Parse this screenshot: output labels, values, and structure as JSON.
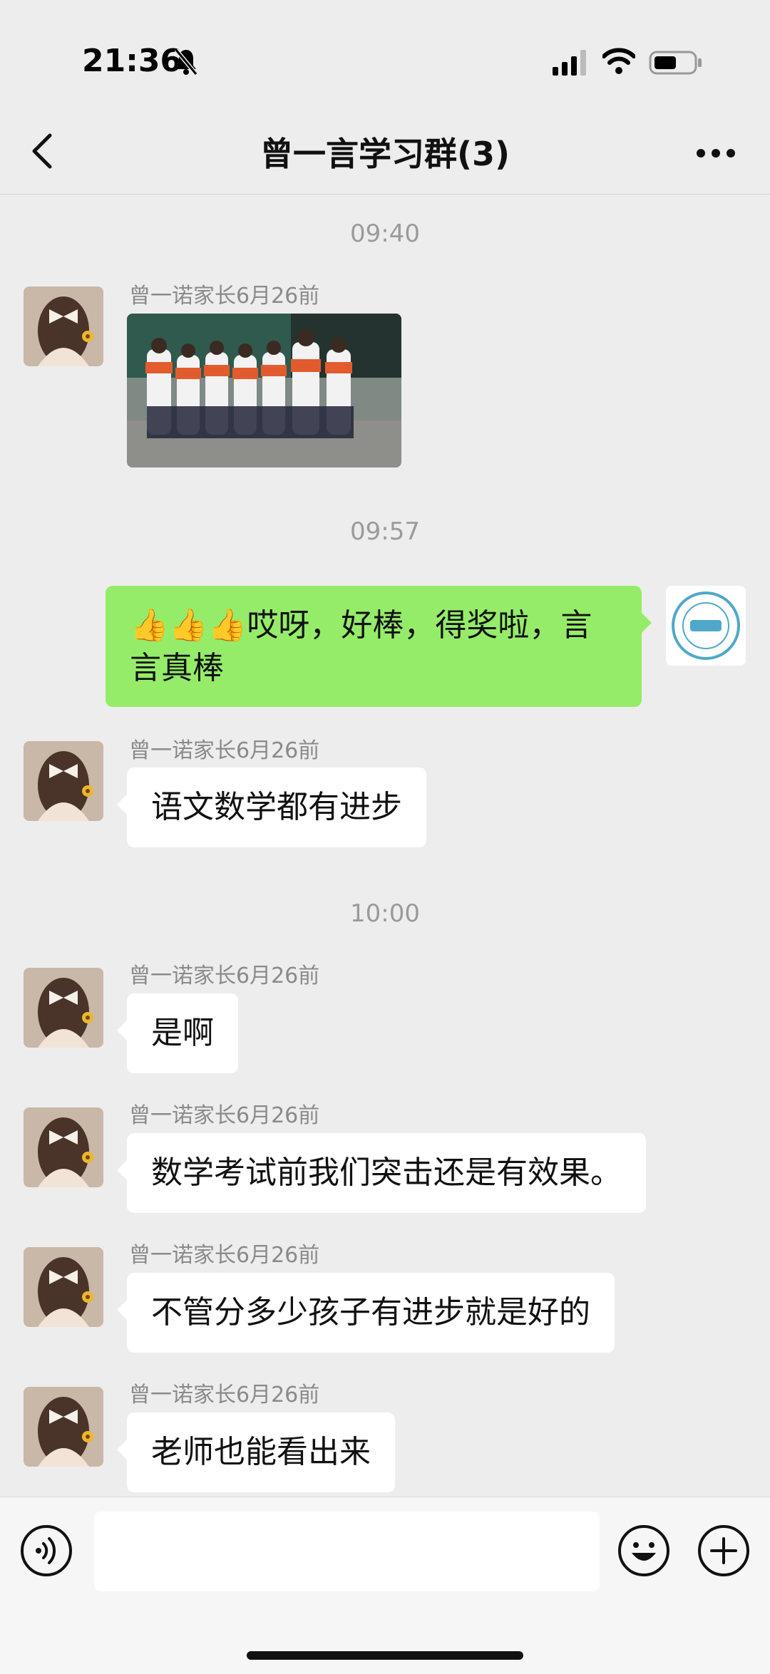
{
  "status_bar": {
    "time": "21:36"
  },
  "header": {
    "title": "曾一言学习群(3)"
  },
  "chat": {
    "sender_name": "曾一诺家长6月26前",
    "timestamps": [
      "09:40",
      "09:57",
      "10:00"
    ],
    "messages": [
      {
        "side": "left",
        "type": "image",
        "sender": "曾一诺家长6月26前"
      },
      {
        "side": "right",
        "type": "text",
        "text": "👍👍👍哎呀，好棒，得奖啦，言言真棒"
      },
      {
        "side": "left",
        "type": "text",
        "text": "语文数学都有进步"
      },
      {
        "side": "left",
        "type": "text",
        "text": "是啊"
      },
      {
        "side": "left",
        "type": "text",
        "text": "数学考试前我们突击还是有效果。"
      },
      {
        "side": "left",
        "type": "text",
        "text": "不管分多少孩子有进步就是好的"
      },
      {
        "side": "left",
        "type": "text",
        "text": "老师也能看出来"
      }
    ]
  },
  "input": {
    "placeholder": ""
  },
  "icons": [
    "back-icon",
    "more-icon",
    "voice-icon",
    "emoji-icon",
    "plus-icon",
    "signal-icon",
    "wifi-icon",
    "battery-icon",
    "mute-bell-icon"
  ],
  "colors": {
    "background": "#ededed",
    "self_bubble": "#95ec69",
    "other_bubble": "#ffffff"
  }
}
